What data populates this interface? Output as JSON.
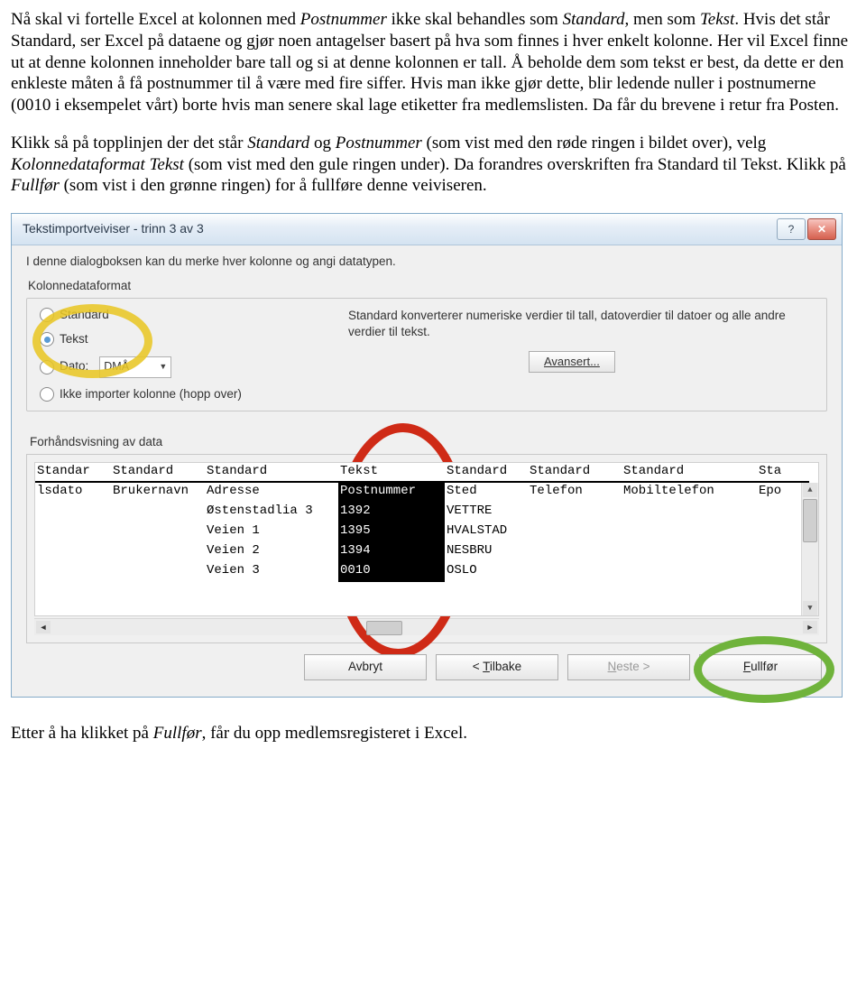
{
  "para1": {
    "t1": "Nå skal vi fortelle Excel at kolonnen med ",
    "i1": "Postnummer",
    "t2": " ikke skal behandles som ",
    "i2": "Standard",
    "t3": ", men som ",
    "i3": "Tekst",
    "t4": ". Hvis det står Standard, ser Excel på dataene og gjør noen antagelser basert på hva som finnes i hver enkelt kolonne. Her vil Excel finne ut at denne kolonnen inneholder bare tall og si at denne kolonnen er tall. Å beholde dem som tekst er best, da dette er den enkleste måten å få postnummer til å være med fire siffer. Hvis man ikke gjør dette, blir ledende nuller i postnumerne (0010 i eksempelet vårt) borte hvis man senere skal lage etiketter fra medlemslisten. Da får du brevene i retur fra Posten."
  },
  "para2": {
    "t1": "Klikk så på topplinjen der det står ",
    "i1": "Standard",
    "t2": " og ",
    "i2": "Postnummer",
    "t3": " (som vist med den røde ringen i bildet over), velg ",
    "i3": "Kolonnedataformat Tekst",
    "t4": " (som vist med den gule ringen under). Da forandres overskriften fra Standard til Tekst. Klikk på ",
    "i4": "Fullfør",
    "t5": " (som vist i den grønne ringen) for å fullføre denne veiviseren."
  },
  "dialog": {
    "title": "Tekstimportveiviser - trinn 3 av 3",
    "info": "I denne dialogboksen kan du merke hver kolonne og angi datatypen.",
    "group": "Kolonnedataformat",
    "radios": {
      "standard": "Standard",
      "tekst": "Tekst",
      "dato": "Dato:",
      "dato_val": "DMÅ",
      "skip": "Ikke importer kolonne (hopp over)"
    },
    "right_text": "Standard konverterer numeriske verdier til tall, datoverdier til datoer og alle andre verdier til tekst.",
    "advanced": "Avansert...",
    "preview_label": "Forhåndsvisning av data",
    "columns": {
      "headers": [
        "Standar",
        "Standard",
        "Standard",
        "Tekst",
        "Standard",
        "Standard",
        "Standard",
        "Sta"
      ],
      "row1": [
        "lsdato",
        "Brukernavn",
        "Adresse",
        "Postnummer",
        "Sted",
        "Telefon",
        "Mobiltelefon",
        "Epo"
      ],
      "rows": [
        [
          "",
          "",
          "Østenstadlia 3",
          "1392",
          "VETTRE",
          "",
          "",
          ""
        ],
        [
          "",
          "",
          "Veien 1",
          "1395",
          "HVALSTAD",
          "",
          "",
          ""
        ],
        [
          "",
          "",
          "Veien 2",
          "1394",
          "NESBRU",
          "",
          "",
          ""
        ],
        [
          "",
          "",
          "Veien 3",
          "0010",
          "OSLO",
          "",
          "",
          ""
        ]
      ]
    },
    "buttons": {
      "cancel": "Avbryt",
      "back": "< Tilbake",
      "next": "Neste >",
      "finish": "Fullfør"
    }
  },
  "para3": {
    "t1": "Etter å ha klikket på ",
    "i1": "Fullfør",
    "t2": ", får du opp medlemsregisteret i Excel."
  }
}
